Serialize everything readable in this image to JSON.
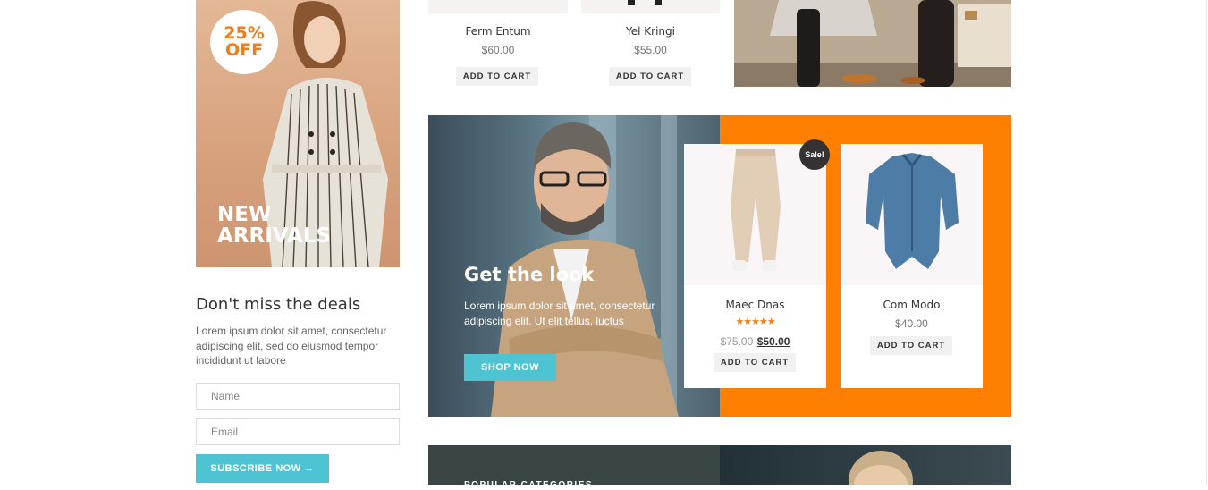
{
  "promo": {
    "badge_line1": "25%",
    "badge_line2": "OFF",
    "headline_line1": "NEW",
    "headline_line2": "ARRIVALS"
  },
  "newsletter": {
    "title": "Don't miss the deals",
    "text": "Lorem ipsum dolor sit amet, consectetur adipiscing elit, sed do eiusmod tempor incididunt ut labore",
    "name_placeholder": "Name",
    "email_placeholder": "Email",
    "subscribe_label": "SUBSCRIBE NOW →"
  },
  "top_products": [
    {
      "name": "Ferm Entum",
      "price": "$60.00",
      "cart_label": "ADD TO CART"
    },
    {
      "name": "Yel Kringi",
      "price": "$55.00",
      "cart_label": "ADD TO CART"
    }
  ],
  "look": {
    "title": "Get the look",
    "text": "Lorem ipsum dolor sit amet, consectetur adipiscing elit. Ut elit tellus, luctus",
    "button_label": "SHOP NOW"
  },
  "featured_products": [
    {
      "name": "Maec Dnas",
      "sale_badge": "Sale!",
      "rating": "★★★★★",
      "old_price": "$75.00",
      "price": "$50.00",
      "cart_label": "ADD TO CART"
    },
    {
      "name": "Com Modo",
      "price": "$40.00",
      "cart_label": "ADD TO CART"
    }
  ],
  "bottom": {
    "label": "POPULAR CATEGORIES"
  },
  "colors": {
    "accent_teal": "#4ec4d3",
    "accent_orange": "#ff7f00",
    "badge_text": "#ef7f1a"
  }
}
